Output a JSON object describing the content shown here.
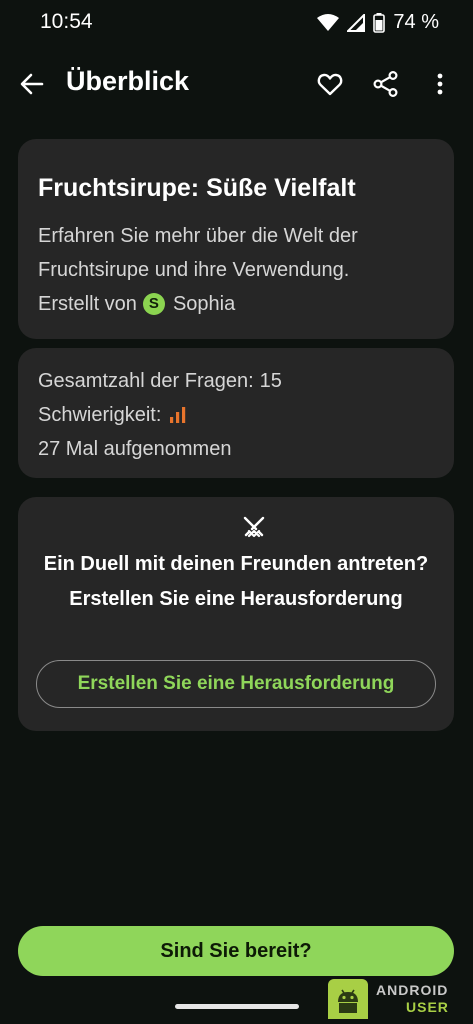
{
  "status_bar": {
    "time": "10:54",
    "battery": "74 %"
  },
  "app_bar": {
    "title": "Überblick",
    "back_icon": "arrow-left-icon",
    "favorite_icon": "heart-outline-icon",
    "share_icon": "share-icon",
    "more_icon": "more-vertical-icon"
  },
  "quiz": {
    "title": "Fruchtsirupe: Süße Vielfalt",
    "description": "Erfahren Sie mehr über die Welt der Fruchtsirupe und ihre Verwendung.",
    "author_prefix": "Erstellt von",
    "author_initial": "S",
    "author_name": "Sophia"
  },
  "stats": {
    "questions_label": "Gesamtzahl der Fragen:",
    "questions_count": "15",
    "difficulty_label": "Schwierigkeit:",
    "difficulty_icon": "difficulty-bars-icon",
    "taken_text": "27 Mal aufgenommen"
  },
  "challenge": {
    "icon": "crossed-swords-icon",
    "text": "Ein Duell mit deinen Freunden antreten? Erstellen Sie eine Herausforderung",
    "button_label": "Erstellen Sie eine Herausforderung"
  },
  "bottom": {
    "ready_label": "Sind Sie bereit?"
  },
  "watermark": {
    "line1": "ANDROID",
    "line2": "USER"
  },
  "colors": {
    "background": "#0d120f",
    "card": "#262626",
    "accent_green": "#8fd65a",
    "difficulty_orange": "#e8742c"
  }
}
